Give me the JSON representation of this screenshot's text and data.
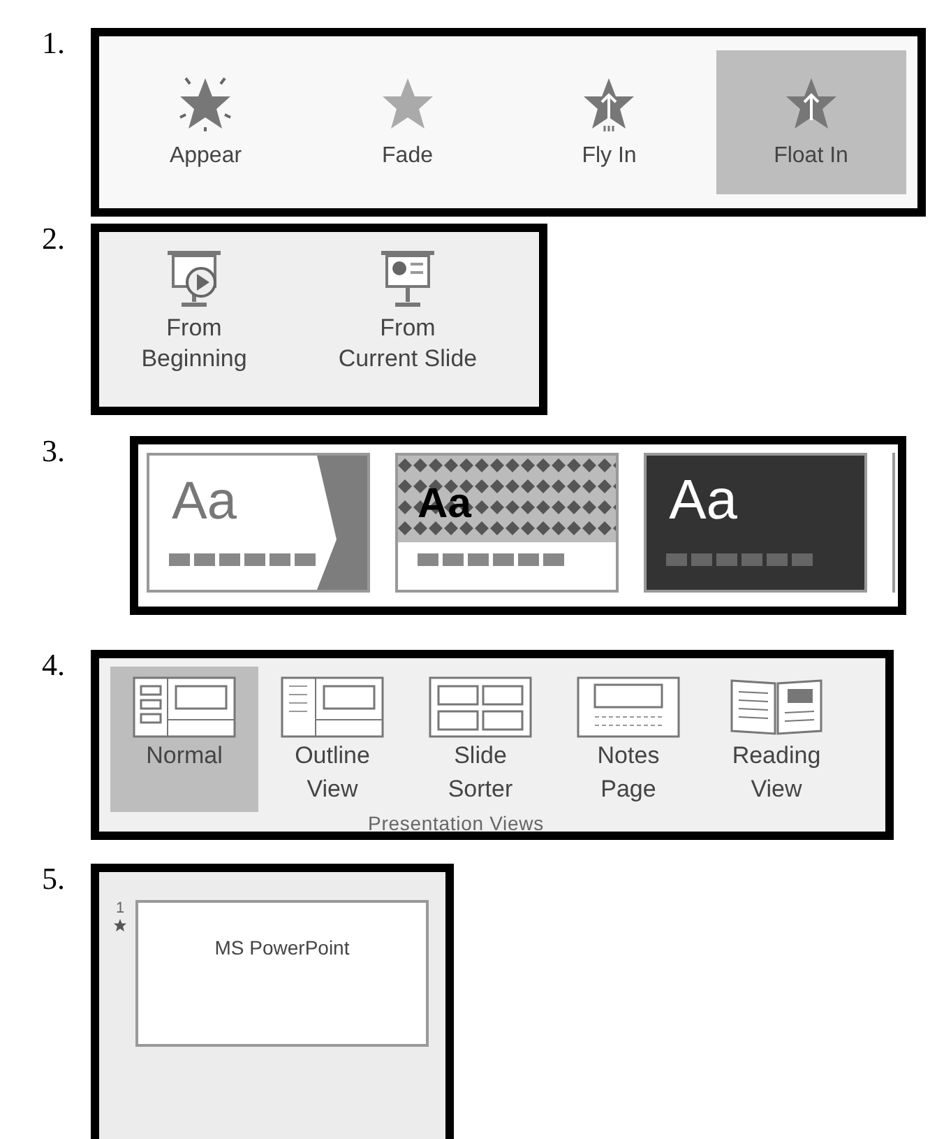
{
  "sections": [
    {
      "number": "1.",
      "kind": "animations",
      "items": [
        {
          "label": "Appear",
          "selected": false
        },
        {
          "label": "Fade",
          "selected": false
        },
        {
          "label": "Fly In",
          "selected": false
        },
        {
          "label": "Float In",
          "selected": true
        }
      ]
    },
    {
      "number": "2.",
      "kind": "slideshow",
      "items": [
        {
          "lines": [
            "From",
            "Beginning"
          ]
        },
        {
          "lines": [
            "From",
            "Current Slide"
          ]
        }
      ]
    },
    {
      "number": "3.",
      "kind": "themes",
      "items": [
        {
          "sample": "Aa"
        },
        {
          "sample": "Aa"
        },
        {
          "sample": "Aa"
        }
      ]
    },
    {
      "number": "4.",
      "kind": "views",
      "group_label": "Presentation Views",
      "items": [
        {
          "lines": [
            "Normal"
          ],
          "selected": true
        },
        {
          "lines": [
            "Outline",
            "View"
          ],
          "selected": false
        },
        {
          "lines": [
            "Slide",
            "Sorter"
          ],
          "selected": false
        },
        {
          "lines": [
            "Notes",
            "Page"
          ],
          "selected": false
        },
        {
          "lines": [
            "Reading",
            "View"
          ],
          "selected": false
        }
      ]
    },
    {
      "number": "5.",
      "kind": "thumbnail",
      "slide_number": "1",
      "slide_title": "MS PowerPoint"
    }
  ]
}
